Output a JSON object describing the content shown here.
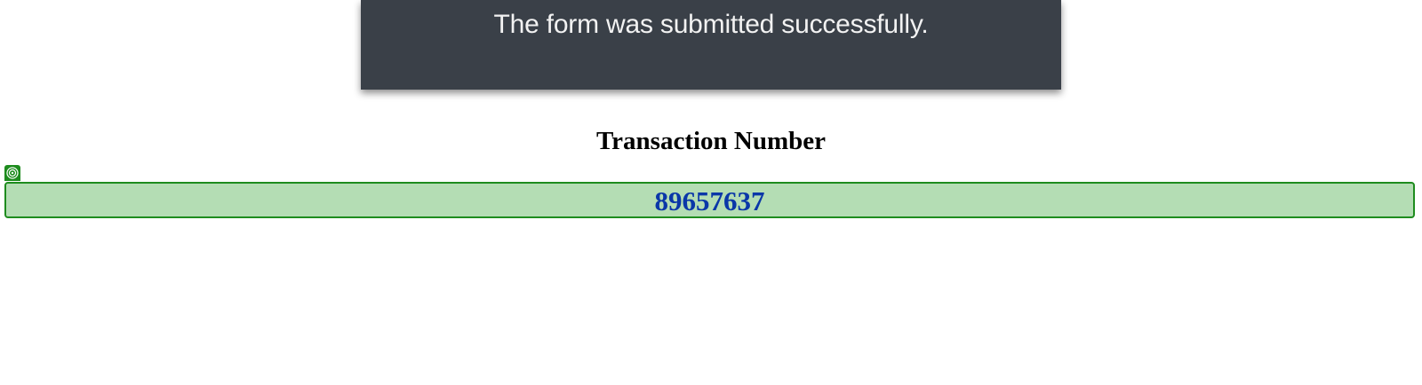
{
  "toast": {
    "message": "The form was submitted successfully."
  },
  "transaction": {
    "title": "Transaction Number",
    "number": "89657637",
    "marker_icon": "target-icon"
  },
  "colors": {
    "toast_background": "#3a4048",
    "box_background": "#b4ddb4",
    "box_border": "#1e8c1e",
    "number_text": "#0a37a8"
  }
}
